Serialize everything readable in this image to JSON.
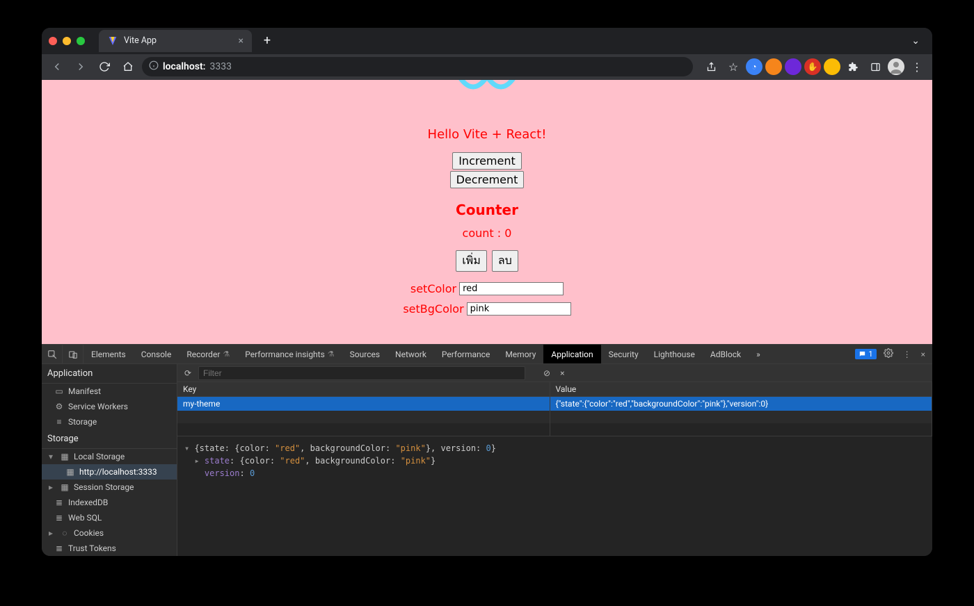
{
  "browser": {
    "tab_title": "Vite App",
    "url_host": "localhost:",
    "url_port": "3333",
    "extensions": [
      {
        "name": "ext-1",
        "bg": "#3b82f6"
      },
      {
        "name": "ext-metamask",
        "bg": "#f6851b"
      },
      {
        "name": "ext-3",
        "bg": "#6d28d9"
      },
      {
        "name": "ext-ublock",
        "bg": "#d93025"
      },
      {
        "name": "ext-5",
        "bg": "#fbbc05"
      }
    ]
  },
  "app": {
    "hello": "Hello Vite + React!",
    "increment": "Increment",
    "decrement": "Decrement",
    "counter_heading": "Counter",
    "count_label": "count : 0",
    "btn_add": "เพิ่ม",
    "btn_del": "ลบ",
    "setcolor_label": "setColor",
    "setcolor_value": "red",
    "setbg_label": "setBgColor",
    "setbg_value": "pink"
  },
  "devtools": {
    "tabs": [
      "Elements",
      "Console",
      "Recorder",
      "Performance insights",
      "Sources",
      "Network",
      "Performance",
      "Memory",
      "Application",
      "Security",
      "Lighthouse",
      "AdBlock"
    ],
    "active_tab": "Application",
    "issue_count": "1",
    "filter_placeholder": "Filter",
    "side": {
      "app_h": "Application",
      "app_items": [
        "Manifest",
        "Service Workers",
        "Storage"
      ],
      "storage_h": "Storage",
      "local_storage": "Local Storage",
      "local_storage_origin": "http://localhost:3333",
      "session_storage": "Session Storage",
      "indexeddb": "IndexedDB",
      "websql": "Web SQL",
      "cookies": "Cookies",
      "trust_tokens": "Trust Tokens"
    },
    "table": {
      "key_h": "Key",
      "value_h": "Value",
      "row_key": "my-theme",
      "row_value": "{\"state\":{\"color\":\"red\",\"backgroundColor\":\"pink\"},\"version\":0}"
    },
    "preview": {
      "line1_prefix": "{state: {color: ",
      "l1_v1": "\"red\"",
      "l1_mid1": ", backgroundColor: ",
      "l1_v2": "\"pink\"",
      "l1_mid2": "}, version: ",
      "l1_v3": "0",
      "l1_end": "}",
      "l2_key": "state",
      "l2_body_a": "{color: ",
      "l2_v1": "\"red\"",
      "l2_body_b": ", backgroundColor: ",
      "l2_v2": "\"pink\"",
      "l2_body_c": "}",
      "l3_key": "version",
      "l3_val": "0"
    }
  }
}
